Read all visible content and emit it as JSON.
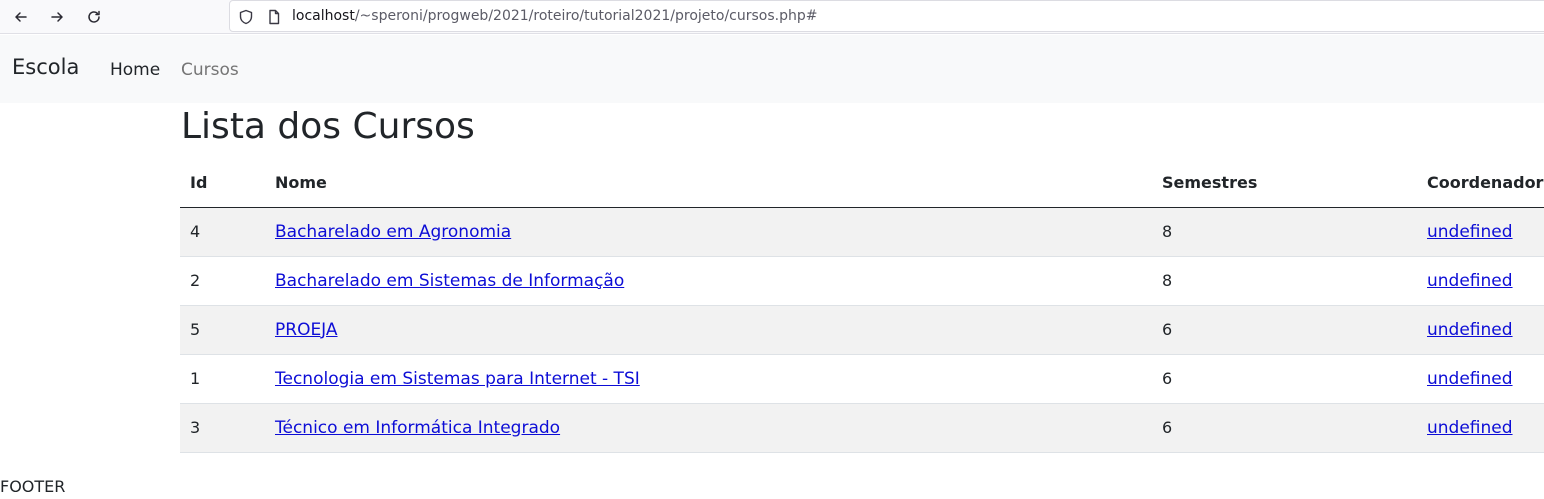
{
  "browser": {
    "url_host": "localhost",
    "url_path": "/~speroni/progweb/2021/roteiro/tutorial2021/projeto/cursos.php#",
    "icons": [
      "back-arrow-icon",
      "forward-arrow-icon",
      "reload-icon",
      "shield-icon",
      "page-icon"
    ]
  },
  "navbar": {
    "brand": "Escola",
    "links": [
      {
        "label": "Home",
        "active": true
      },
      {
        "label": "Cursos",
        "active": false
      }
    ]
  },
  "main": {
    "title": "Lista dos Cursos",
    "table": {
      "headers": [
        "Id",
        "Nome",
        "Semestres",
        "Coordenador"
      ],
      "rows": [
        {
          "id": "4",
          "nome": "Bacharelado em Agronomia",
          "semestres": "8",
          "coordenador": "undefined"
        },
        {
          "id": "2",
          "nome": "Bacharelado em Sistemas de Informação",
          "semestres": "8",
          "coordenador": "undefined"
        },
        {
          "id": "5",
          "nome": "PROEJA",
          "semestres": "6",
          "coordenador": "undefined"
        },
        {
          "id": "1",
          "nome": "Tecnologia em Sistemas para Internet - TSI",
          "semestres": "6",
          "coordenador": "undefined"
        },
        {
          "id": "3",
          "nome": "Técnico em Informática Integrado",
          "semestres": "6",
          "coordenador": "undefined"
        }
      ]
    }
  },
  "footer": {
    "text": "FOOTER"
  },
  "colors": {
    "link": "#0d0dd6",
    "navbar_bg": "#f8f9fa",
    "stripe": "#f2f2f2"
  }
}
